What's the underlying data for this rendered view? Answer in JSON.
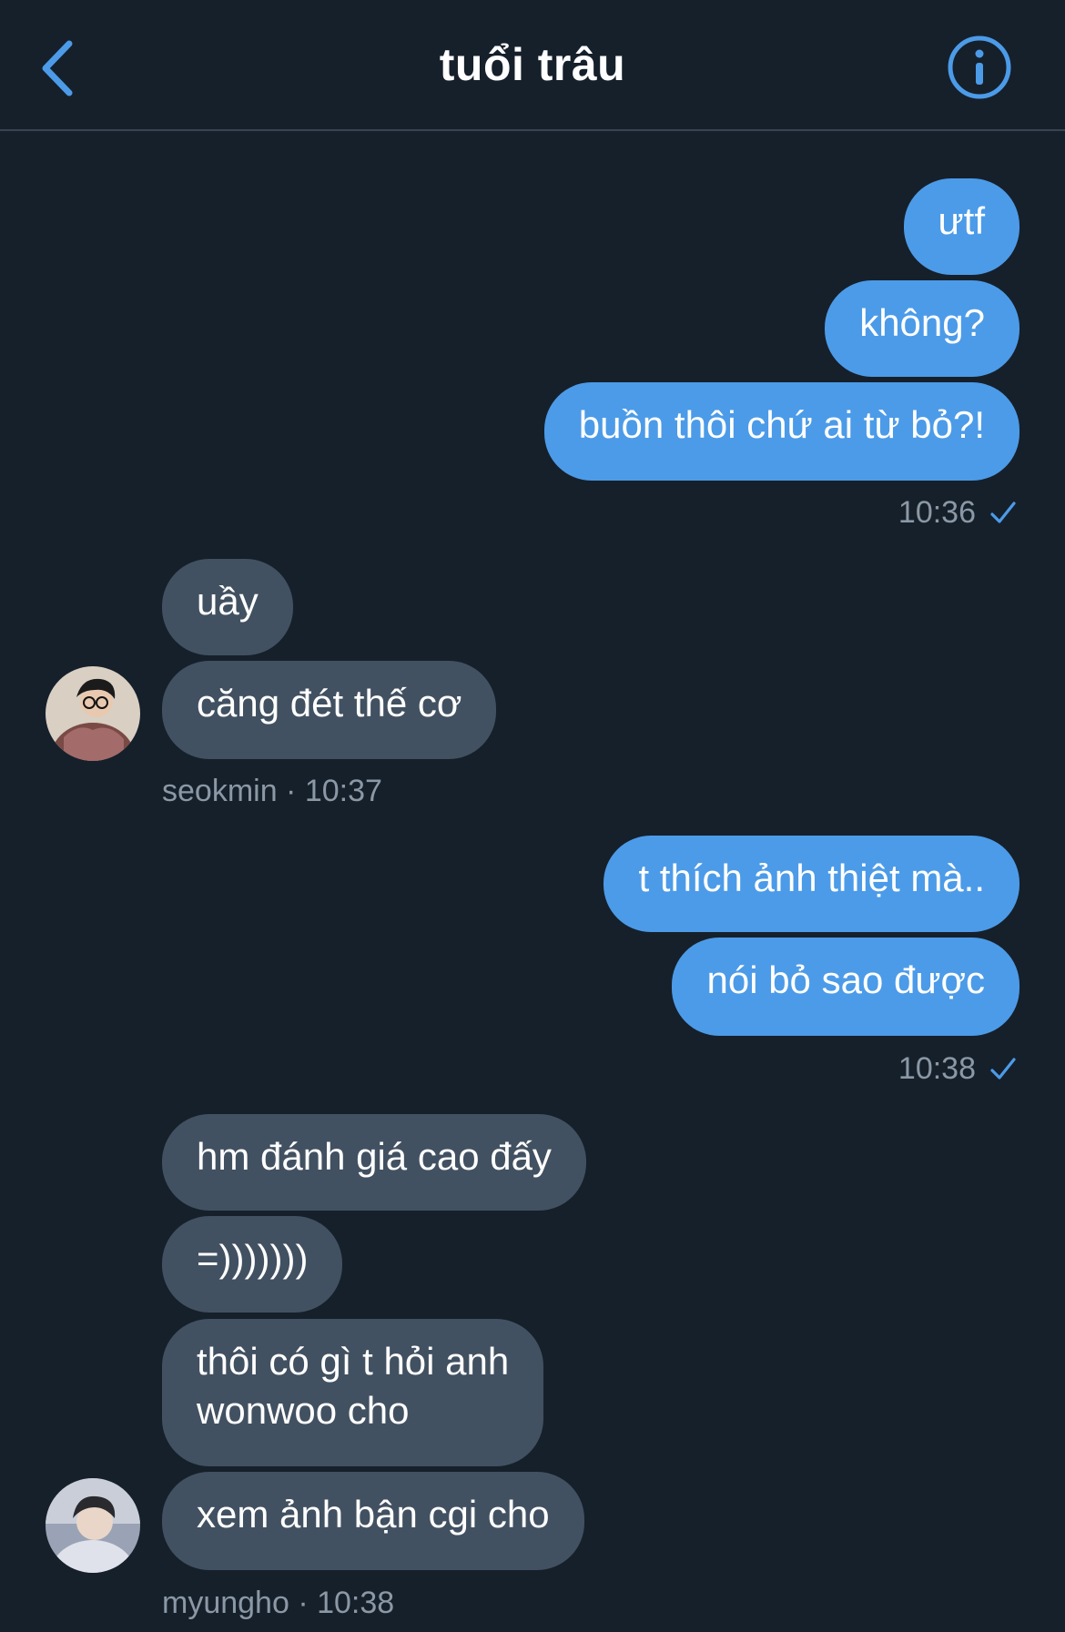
{
  "header": {
    "title": "tuổi trâu",
    "back_icon": "chevron-left-icon",
    "info_icon": "info-circle-icon"
  },
  "colors": {
    "background": "#16202b",
    "outgoing_bubble": "#4c9be8",
    "incoming_bubble": "#425161",
    "accent": "#4c9be8",
    "meta_text": "#8b98a5"
  },
  "messages": [
    {
      "text": "ưtf"
    },
    {
      "text": "không?"
    },
    {
      "text": "buồn thôi chứ ai từ bỏ?!"
    },
    {
      "text": "uầy"
    },
    {
      "text": "căng đét thế cơ"
    },
    {
      "text": "t thích ảnh thiệt mà.."
    },
    {
      "text": "nói bỏ sao được"
    },
    {
      "text": "hm đánh giá cao đấy"
    },
    {
      "text": "=)))))))"
    },
    {
      "text": "thôi có gì t hỏi anh"
    },
    {
      "text": "wonwoo cho"
    },
    {
      "text": "xem ảnh bận cgi cho"
    }
  ],
  "meta": {
    "out_time_1": "10:36",
    "in_meta_1": "seokmin · 10:37",
    "out_time_2": "10:38",
    "in_meta_2": "myungho · 10:38"
  }
}
